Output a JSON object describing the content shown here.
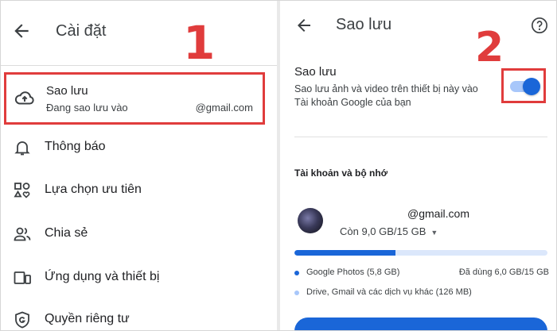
{
  "settings": {
    "title": "Cài đặt",
    "step_label": "1",
    "backup": {
      "title": "Sao lưu",
      "subtitle": "Đang sao lưu vào",
      "email": "@gmail.com"
    },
    "menu": [
      {
        "label": "Thông báo",
        "icon": "bell-icon"
      },
      {
        "label": "Lựa chọn ưu tiên",
        "icon": "preferences-icon"
      },
      {
        "label": "Chia sẻ",
        "icon": "people-icon"
      },
      {
        "label": "Ứng dụng và thiết bị",
        "icon": "devices-icon"
      },
      {
        "label": "Quyền riêng tư",
        "icon": "shield-icon"
      }
    ]
  },
  "backup_page": {
    "title": "Sao lưu",
    "step_label": "2",
    "toggle_title": "Sao lưu",
    "toggle_description": "Sao lưu ảnh và video trên thiết bị này vào Tài khoản Google của bạn",
    "toggle_on": true,
    "account_section_title": "Tài khoản và bộ nhớ",
    "email": "@gmail.com",
    "storage_remaining": "Còn 9,0 GB/15 GB",
    "storage_used_fraction": 0.4,
    "legend": [
      {
        "label": "Google Photos (5,8 GB)",
        "color": "#1a66d8",
        "extra": "Đã dùng 6,0 GB/15 GB"
      },
      {
        "label": "Drive, Gmail và các dịch vụ khác (126 MB)",
        "color": "#a8c7fa",
        "extra": ""
      }
    ]
  },
  "colors": {
    "accent": "#1a66d8",
    "highlight": "#e03c3c"
  }
}
